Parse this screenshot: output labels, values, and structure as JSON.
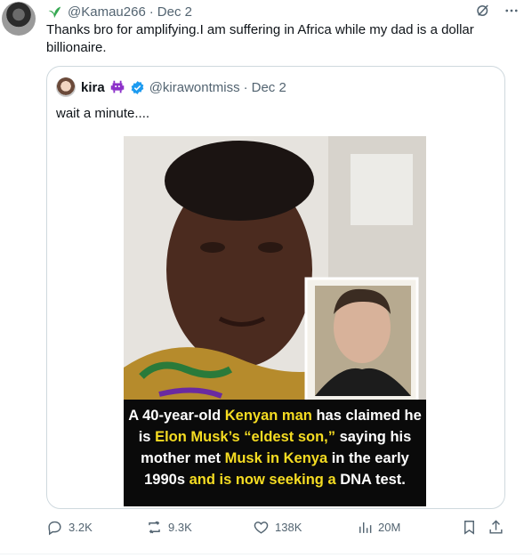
{
  "tweet": {
    "handle": "@Kamau266",
    "separator": "·",
    "date": "Dec 2",
    "text": "Thanks bro for amplifying.I am suffering in Africa while my dad is a dollar billionaire."
  },
  "quoted": {
    "name": "kira",
    "handle": "@kirawontmiss",
    "separator": "·",
    "date": "Dec 2",
    "text": "wait a minute....",
    "media": {
      "caption_parts": [
        {
          "text": "A 40-year-old ",
          "highlight": false
        },
        {
          "text": "Kenyan man",
          "highlight": true
        },
        {
          "text": " has claimed he is ",
          "highlight": false
        },
        {
          "text": "Elon Musk’s “eldest son,”",
          "highlight": true
        },
        {
          "text": " saying his mother met ",
          "highlight": false
        },
        {
          "text": "Musk in Kenya",
          "highlight": true
        },
        {
          "text": " in the early 1990s ",
          "highlight": false
        },
        {
          "text": "and is now seeking a",
          "highlight": true
        },
        {
          "text": " DNA test.",
          "highlight": false
        }
      ]
    }
  },
  "stats": {
    "replies": "3.2K",
    "reposts": "9.3K",
    "likes": "138K",
    "views": "20M"
  },
  "colors": {
    "accent": "#1d9bf0",
    "muted": "#536471",
    "highlight": "#f5dc22"
  }
}
